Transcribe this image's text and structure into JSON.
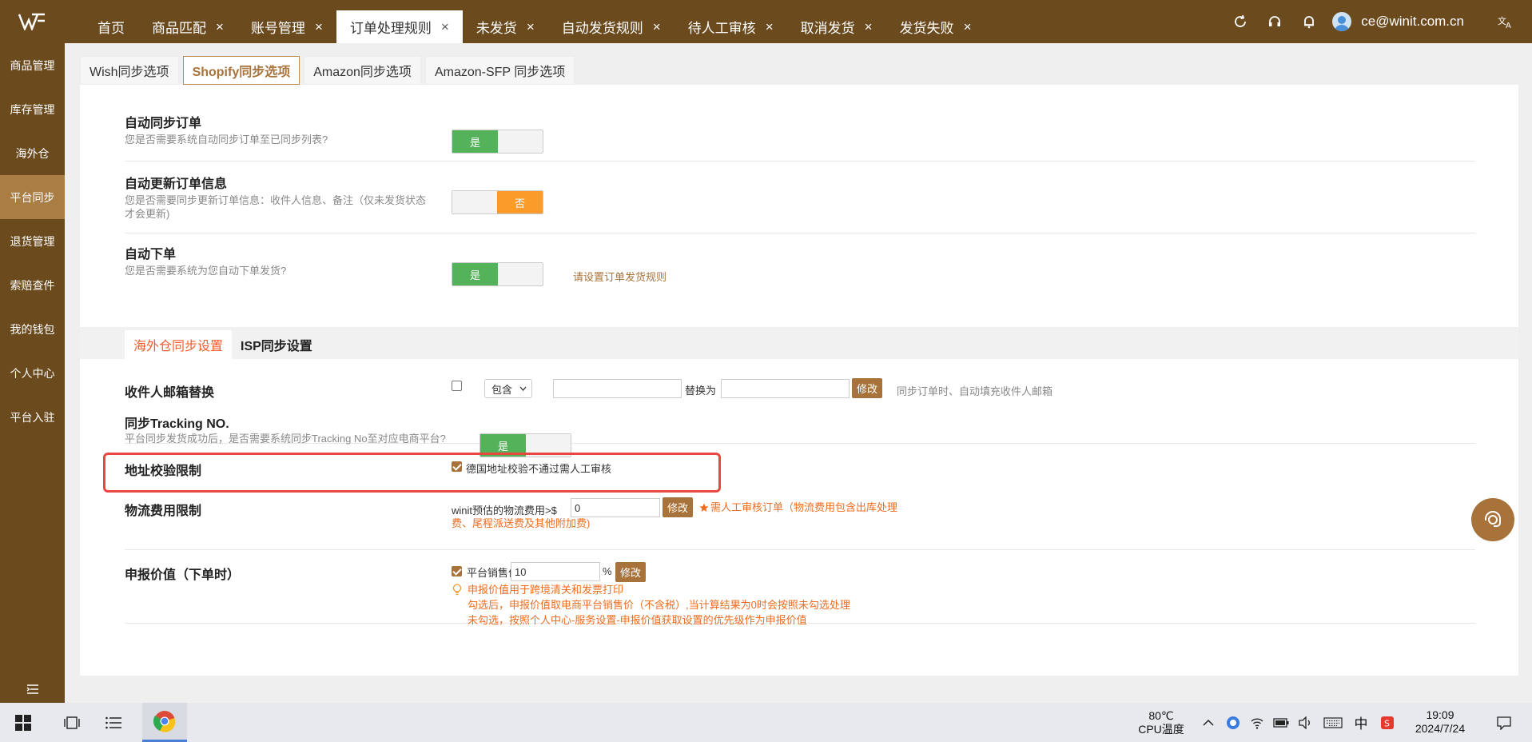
{
  "header": {
    "tabs": [
      {
        "label": "首页",
        "closable": false
      },
      {
        "label": "商品匹配",
        "closable": true
      },
      {
        "label": "账号管理",
        "closable": true
      },
      {
        "label": "订单处理规则",
        "closable": true,
        "active": true
      },
      {
        "label": "未发货",
        "closable": true
      },
      {
        "label": "自动发货规则",
        "closable": true
      },
      {
        "label": "待人工审核",
        "closable": true
      },
      {
        "label": "取消发货",
        "closable": true
      },
      {
        "label": "发货失败",
        "closable": true
      }
    ],
    "close_glyph": "×",
    "user_email": "ce@winit.com.cn",
    "icons": [
      "refresh-icon",
      "headset-icon",
      "bell-icon",
      "translate-icon"
    ]
  },
  "sidebar": {
    "items": [
      "商品管理",
      "库存管理",
      "海外仓",
      "平台同步",
      "退货管理",
      "索赔查件",
      "我的钱包",
      "个人中心",
      "平台入驻"
    ],
    "active_index": 3
  },
  "subtabs": [
    "Wish同步选项",
    "Shopify同步选项",
    "Amazon同步选项",
    "Amazon-SFP 同步选项"
  ],
  "subtab_active": 1,
  "settings": {
    "auto_sync": {
      "title": "自动同步订单",
      "desc": "您是否需要系统自动同步订单至已同步列表?",
      "value": "是"
    },
    "auto_update": {
      "title": "自动更新订单信息",
      "desc1": "您是否需要同步更新订单信息：收件人信息、备注（仅未发货状态",
      "desc2": "才会更新)",
      "value": "否"
    },
    "auto_order": {
      "title": "自动下单",
      "desc": "您是否需要系统为您自动下单发货?",
      "value": "是",
      "link": "请设置订单发货规则"
    }
  },
  "section_tabs": [
    "海外仓同步设置",
    "ISP同步设置"
  ],
  "email_replace": {
    "title": "收件人邮箱替换",
    "select_value": "包含",
    "replace_label": "替换为",
    "button": "修改",
    "hint": "同步订单时、自动填充收件人邮箱"
  },
  "tracking": {
    "title": "同步Tracking NO.",
    "desc": "平台同步发货成功后，是否需要系统同步Tracking No至对应电商平台?",
    "value": "是"
  },
  "address_check": {
    "title": "地址校验限制",
    "checkbox_label": "德国地址校验不通过需人工审核",
    "checked": true
  },
  "logistics": {
    "title": "物流费用限制",
    "label": "winit预估的物流费用>$",
    "value": "0",
    "button": "修改",
    "note1": "需人工审核订单（物流费用包含出库处理",
    "note2": "费、尾程派送费及其他附加费)"
  },
  "declared": {
    "title": "申报价值（下单时）",
    "checkbox_label": "平台销售价",
    "value": "10",
    "unit": "%",
    "button": "修改",
    "note1": "申报价值用于跨境清关和发票打印",
    "note2": "勾选后，申报价值取电商平台销售价（不含税）,当计算结果为0时会按照未勾选处理",
    "note3": "未勾选，按照个人中心-服务设置-申报价值获取设置的优先级作为申报价值"
  },
  "taskbar": {
    "temp": "80℃",
    "temp_label": "CPU温度",
    "ime": "中",
    "time": "19:09",
    "date": "2024/7/24"
  },
  "colors": {
    "brand": "#6b4a1e",
    "accent": "#a8733a",
    "on": "#54b35a",
    "off": "#fb9b29",
    "highlight": "#e94840"
  }
}
